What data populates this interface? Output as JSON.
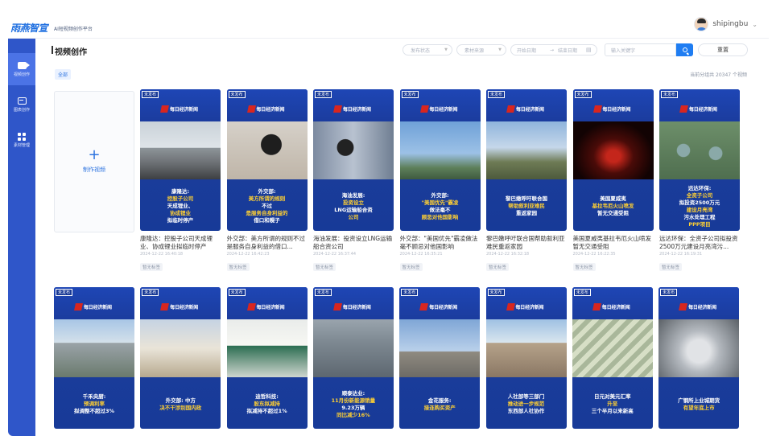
{
  "app": {
    "logo": "雨燕智宣",
    "logo_sub": "AI短视频创作平台",
    "username": "shipingbu",
    "user_caret": "⌄"
  },
  "sidebar": {
    "items": [
      {
        "label": "视频创作",
        "icon": "video-icon",
        "active": true
      },
      {
        "label": "图表创作",
        "icon": "image-icon",
        "active": false
      },
      {
        "label": "素材管理",
        "icon": "grid-icon",
        "active": false
      }
    ]
  },
  "page": {
    "title": "视频创作",
    "filters": {
      "status_placeholder": "发布状态",
      "source_placeholder": "素材来源",
      "start_placeholder": "开始日期",
      "range_sep": "→",
      "end_placeholder": "结束日期",
      "search_placeholder": "输入关键字",
      "reset_label": "重置"
    },
    "tab_all": "全部",
    "count_text": "当前分组共 20347 个视频",
    "new_card_label": "制作视频"
  },
  "cards_row1": [
    {
      "pub": "未发布",
      "brand": "每日经济新闻",
      "cap": [
        "康隆达:",
        "控股子公司",
        "天成锂业、",
        "协成锂业",
        "拟临时停产"
      ],
      "title": "康隆达：控股子公司天成锂业、协成锂业拟临时停产",
      "date": "2024-12-22 16:40:18",
      "status": "暂无标签",
      "photo": "building"
    },
    {
      "pub": "未发布",
      "brand": "每日经济新闻",
      "cap": [
        "外交部:",
        "美方所谓的规则",
        "不过",
        "是服务自身利益的",
        "借口和幌子"
      ],
      "title": "外交部：美方所谓的规则不过是服务自身利益的借口...",
      "date": "2024-12-22 16:42:23",
      "status": "暂无标签",
      "photo": "person"
    },
    {
      "pub": "未发布",
      "brand": "每日经济新闻",
      "cap": [
        "海油发展:",
        "投资设立",
        "LNG运输船合资",
        "公司"
      ],
      "title": "海油发展：投资设立LNG运输船合资公司",
      "date": "2024-12-22 16:37:44",
      "status": "暂无标签",
      "photo": "screen"
    },
    {
      "pub": "未发布",
      "brand": "每日经济新闻",
      "cap": [
        "外交部:",
        "\"美国优先\"霸凌",
        "做法毫不",
        "顾忌对他国影响"
      ],
      "title": "外交部：\"美国优先\"霸凌做法毫不顾忌对他国影响",
      "date": "2024-12-22 16:35:21",
      "status": "暂无标签",
      "photo": "liberty"
    },
    {
      "pub": "未发布",
      "brand": "每日经济新闻",
      "cap": [
        "黎巴嫩呼吁联合国",
        "帮助叙利亚难民",
        "重返家园"
      ],
      "title": "黎巴嫩呼吁联合国帮助叙利亚难民重返家园",
      "date": "2024-12-22 16:32:18",
      "status": "暂无标签",
      "photo": "soldiers"
    },
    {
      "pub": "未发布",
      "brand": "每日经济新闻",
      "cap": [
        "美国夏威夷",
        "基拉韦厄火山喷发",
        "暂无交通受阻"
      ],
      "title": "美国夏威夷基拉韦厄火山喷发暂无交通受阻",
      "date": "2024-12-22 16:22:35",
      "status": "暂无标签",
      "photo": "volcano"
    },
    {
      "pub": "未发布",
      "brand": "每日经济新闻",
      "cap": [
        "远达环保:",
        "全资子公司",
        "拟投资2500万元",
        "建设月亮湾",
        "污水处理工程",
        "PPP项目"
      ],
      "title": "远达环保：全资子公司拟投资2500万元建设月亮湾污...",
      "date": "2024-12-22 16:19:31",
      "status": "暂无标签",
      "photo": "plant"
    }
  ],
  "cards_row2": [
    {
      "pub": "未发布",
      "brand": "每日经济新闻",
      "cap": [
        "千禾央厨:",
        "预调利率",
        "拟调整不超过3%"
      ],
      "photo": "campus"
    },
    {
      "pub": "未发布",
      "brand": "每日经济新闻",
      "cap": [
        "外交部: 中方",
        "决不干涉别国内政"
      ],
      "photo": "ministry"
    },
    {
      "pub": "未发布",
      "brand": "每日经济新闻",
      "cap": [
        "迪哲科技:",
        "股东拟减持",
        "拟减持不超过1%"
      ],
      "photo": "sign"
    },
    {
      "pub": "未发布",
      "brand": "每日经济新闻",
      "cap": [
        "顺泰达业:",
        "11月份新能源销量",
        "9.23万辆",
        "同比减少16%"
      ],
      "photo": "factory"
    },
    {
      "pub": "未发布",
      "brand": "每日经济新闻",
      "cap": [
        "金花服务:",
        "接连购买资产"
      ],
      "photo": "crane"
    },
    {
      "pub": "未发布",
      "brand": "每日经济新闻",
      "cap": [
        "人社部等三部门",
        "推动进一步规范",
        "东西部人社协作"
      ],
      "photo": "town"
    },
    {
      "pub": "未发布",
      "brand": "每日经济新闻",
      "cap": [
        "日元对美元汇率",
        "升至",
        "三个半月以来新高"
      ],
      "photo": "money"
    },
    {
      "pub": "未发布",
      "brand": "每日经济新闻",
      "cap": [
        "广钢所上业城期货",
        "有望年底上市"
      ],
      "photo": "silver"
    }
  ],
  "colors": {
    "accent": "#1f7df2",
    "sidebar": "#2f56c9",
    "caption_yellow": "#ffd033",
    "brand_red": "#d8261f"
  }
}
